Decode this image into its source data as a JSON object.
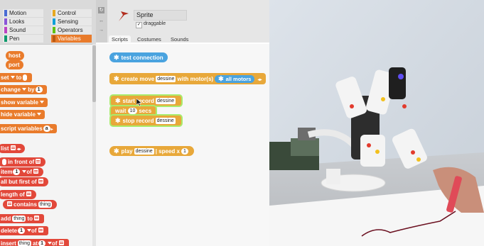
{
  "categories": [
    {
      "label": "Motion",
      "color": "#4a6cd4"
    },
    {
      "label": "Control",
      "color": "#e6a822"
    },
    {
      "label": "Looks",
      "color": "#8a55d7"
    },
    {
      "label": "Sensing",
      "color": "#0d9fd8"
    },
    {
      "label": "Sound",
      "color": "#bb42c3"
    },
    {
      "label": "Operators",
      "color": "#62c213"
    },
    {
      "label": "Pen",
      "color": "#0e9a6c"
    },
    {
      "label": "Variables",
      "color": "#e97b2b"
    }
  ],
  "palette": {
    "host": "host",
    "port": "port",
    "set": "set",
    "to": "to",
    "change": "change",
    "by": "by",
    "by_value": "1",
    "show_variable": "show variable",
    "hide_variable": "hide variable",
    "script_variables": "script variables",
    "script_var_name": "a",
    "list": "list",
    "in_front_of": "in front of",
    "item": "item",
    "item_index": "1",
    "of": "of",
    "all_but_first_of": "all but first of",
    "length_of": "length of",
    "contains": "contains",
    "contains_value": "thing",
    "add": "add",
    "add_value": "thing",
    "delete": "delete",
    "delete_index": "1",
    "insert": "insert",
    "insert_value": "thing",
    "at": "at",
    "insert_index": "1"
  },
  "sprite": {
    "name": "Sprite",
    "draggable_label": "draggable",
    "draggable_checked": true,
    "check_mark": "✓",
    "tabs": [
      "Scripts",
      "Costumes",
      "Sounds"
    ],
    "active_tab": "Scripts"
  },
  "scripts": {
    "test_connection": "test connection",
    "create_move": "create move",
    "create_move_name": "dessine",
    "with_motors": "with motor(s)",
    "all_motors": "all motors",
    "start_record": "start record",
    "start_record_name": "dessine",
    "wait": "wait",
    "wait_value": "10",
    "secs": "secs",
    "stop_record": "stop record",
    "stop_record_name": "dessine",
    "play": "play",
    "play_name": "dessine",
    "speed": "| speed x",
    "speed_value": "1"
  },
  "colors": {
    "variables": "#e97b2b",
    "lists": "#e2483a",
    "robot_blocks": "#4aa3df",
    "move_blocks": "#e8a83a",
    "glow": "#a9ec6d"
  }
}
